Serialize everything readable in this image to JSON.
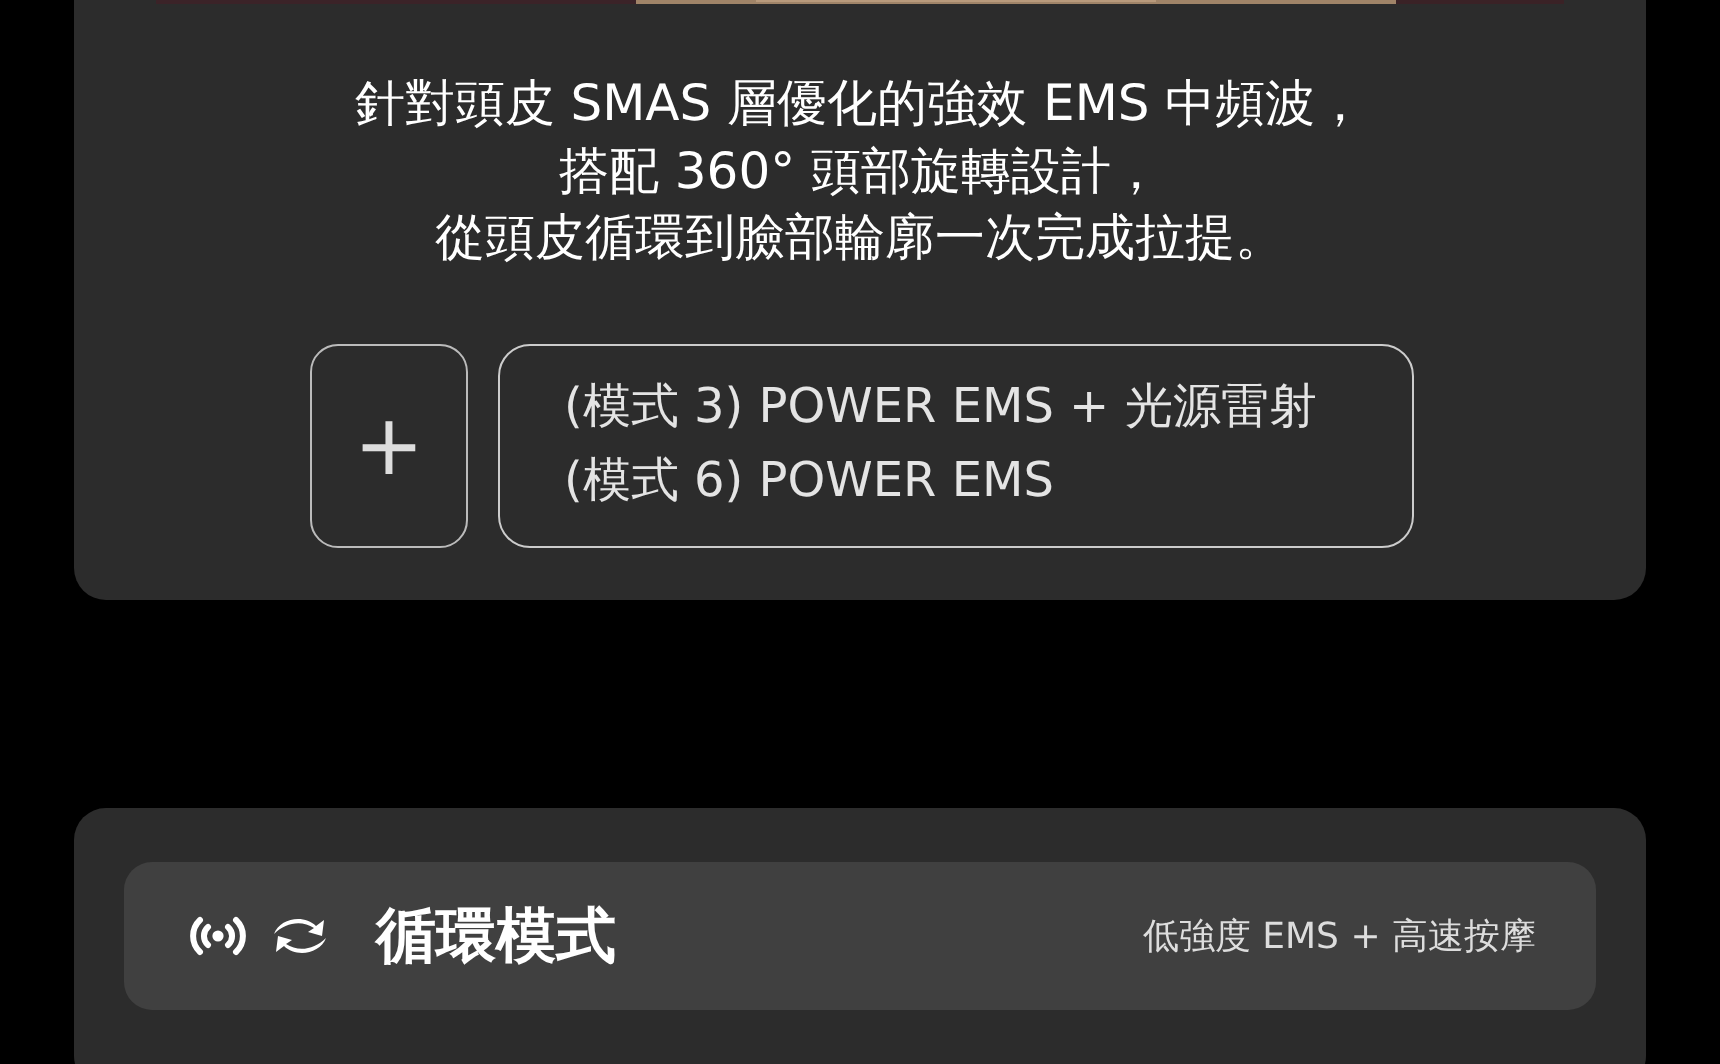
{
  "hero_image": {
    "kind": "picture"
  },
  "description": [
    "針對頭皮 SMAS 層優化的強效 EMS 中頻波，",
    "搭配 360° 頭部旋轉設計，",
    "從頭皮循環到臉部輪廓一次完成拉提。"
  ],
  "add_button": {
    "label": "+"
  },
  "modes": [
    "(模式 3) POWER EMS + 光源雷射",
    "(模式 6) POWER EMS"
  ],
  "cycle_mode": {
    "title": "循環模式",
    "detail": "低強度 EMS + 高速按摩"
  }
}
